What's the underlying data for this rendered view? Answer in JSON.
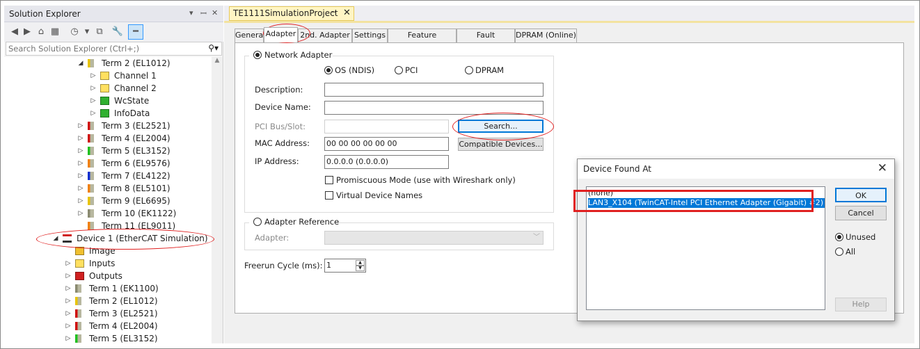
{
  "solution_explorer": {
    "title": "Solution Explorer",
    "pin_icon": "pin-icon",
    "search_placeholder": "Search Solution Explorer (Ctrl+;)",
    "tree": [
      {
        "label": "Term 2 (EL1012)",
        "icon": "terminal-yellow",
        "expanded": true
      },
      {
        "label": "Channel 1",
        "icon": "folder-yellow"
      },
      {
        "label": "Channel 2",
        "icon": "folder-yellow"
      },
      {
        "label": "WcState",
        "icon": "box-green"
      },
      {
        "label": "InfoData",
        "icon": "box-green"
      },
      {
        "label": "Term 3 (EL2521)",
        "icon": "terminal-red"
      },
      {
        "label": "Term 4 (EL2004)",
        "icon": "terminal-red"
      },
      {
        "label": "Term 5 (EL3152)",
        "icon": "terminal-green"
      },
      {
        "label": "Term 6 (EL9576)",
        "icon": "terminal-orange"
      },
      {
        "label": "Term 7 (EL4122)",
        "icon": "terminal-blue"
      },
      {
        "label": "Term 8 (EL5101)",
        "icon": "terminal-orange"
      },
      {
        "label": "Term 9 (EL6695)",
        "icon": "terminal-yellow"
      },
      {
        "label": "Term 10 (EK1122)",
        "icon": "terminal-gray"
      },
      {
        "label": "Term 11 (EL9011)",
        "icon": "terminal-orange"
      },
      {
        "label": "Device 1 (EtherCAT Simulation)",
        "icon": "ethercat-device",
        "expanded": true
      },
      {
        "label": "Image",
        "icon": "image-icon"
      },
      {
        "label": "Inputs",
        "icon": "folder-yellow"
      },
      {
        "label": "Outputs",
        "icon": "folder-red"
      },
      {
        "label": "Term 1 (EK1100)",
        "icon": "terminal-gray"
      },
      {
        "label": "Term 2 (EL1012)",
        "icon": "terminal-yellow"
      },
      {
        "label": "Term 3 (EL2521)",
        "icon": "terminal-red"
      },
      {
        "label": "Term 4 (EL2004)",
        "icon": "terminal-red"
      },
      {
        "label": "Term 5 (EL3152)",
        "icon": "terminal-green"
      }
    ]
  },
  "document": {
    "tab_title": "TE1111SimulationProject",
    "tabs": [
      "General",
      "Adapter",
      "2nd. Adapter",
      "Settings",
      "Feature Simulation",
      "Fault Simulation",
      "DPRAM (Online)"
    ],
    "active_tab": "Adapter",
    "adapter": {
      "network_adapter_label": "Network Adapter",
      "os_label": "OS (NDIS)",
      "pci_label": "PCI",
      "dpram_label": "DPRAM",
      "description_label": "Description:",
      "device_name_label": "Device Name:",
      "pci_bus_label": "PCI Bus/Slot:",
      "mac_label": "MAC Address:",
      "mac_value": "00 00 00 00 00 00",
      "ip_label": "IP Address:",
      "ip_value": "0.0.0.0 (0.0.0.0)",
      "search_button": "Search...",
      "compatible_button": "Compatible Devices...",
      "promiscuous_label": "Promiscuous Mode (use with Wireshark only)",
      "virtual_names_label": "Virtual Device Names",
      "adapter_reference_label": "Adapter Reference",
      "adapter_label": "Adapter:",
      "freerun_label": "Freerun Cycle (ms):",
      "freerun_value": "1"
    }
  },
  "dialog": {
    "title": "Device Found At",
    "items": [
      "(none)",
      "LAN3_X104 (TwinCAT-Intel PCI Ethernet Adapter (Gigabit) #2)"
    ],
    "selected_index": 1,
    "ok": "OK",
    "cancel": "Cancel",
    "unused": "Unused",
    "all": "All",
    "help": "Help"
  },
  "colors": {
    "annotation": "#e02020",
    "selection": "#0078d7",
    "tab_highlight": "#fff5c4"
  }
}
